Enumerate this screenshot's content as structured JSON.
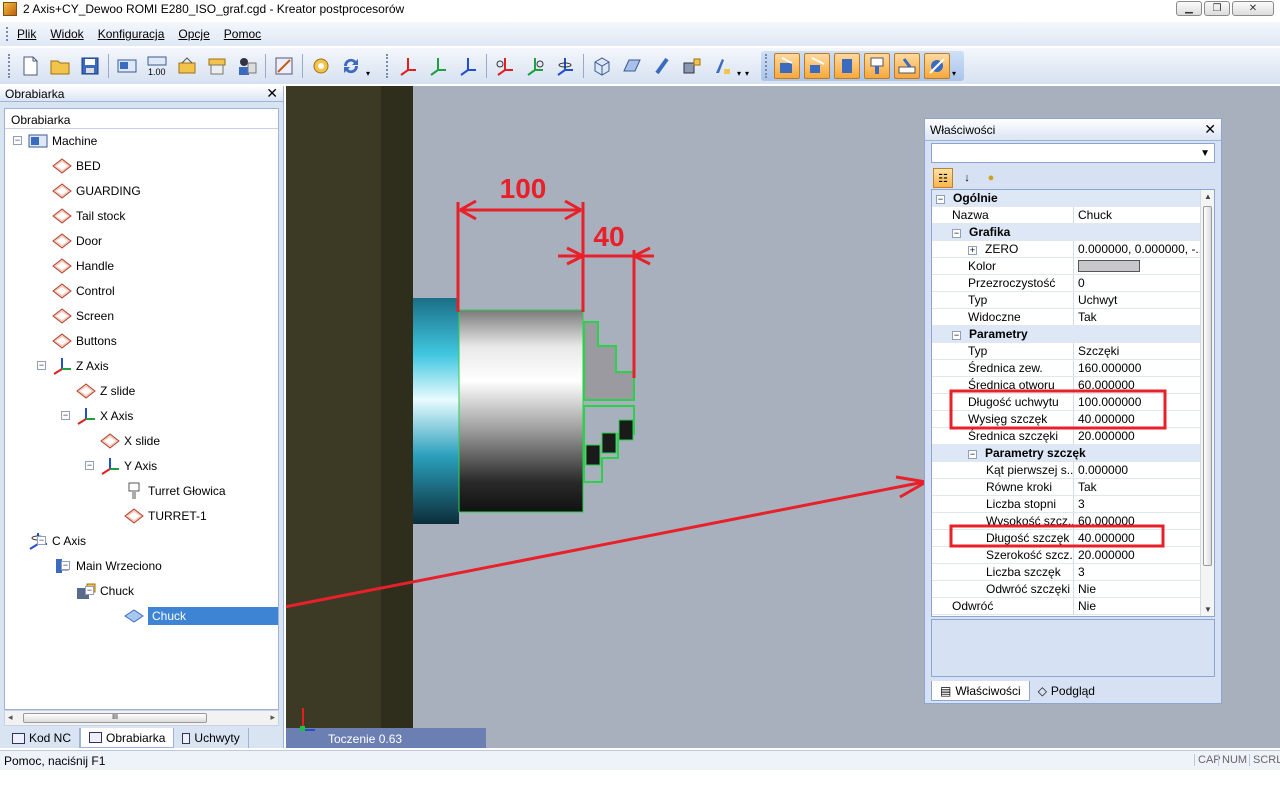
{
  "window": {
    "title": "2 Axis+CY_Dewoo ROMI E280_ISO_graf.cgd - Kreator postprocesorów",
    "btn_min": "▁",
    "btn_max": "❐",
    "btn_close": "✕"
  },
  "menu": [
    "Plik",
    "Widok",
    "Konfiguracja",
    "Opcje",
    "Pomoc"
  ],
  "left_panel": {
    "title": "Obrabiarka",
    "close": "✕",
    "tree_header": "Obrabiarka",
    "nodes": [
      {
        "label": "Machine",
        "icon": "machine-icon"
      },
      {
        "label": "BED",
        "icon": "part-icon"
      },
      {
        "label": "GUARDING",
        "icon": "part-icon"
      },
      {
        "label": "Tail stock",
        "icon": "part-icon"
      },
      {
        "label": "Door",
        "icon": "part-icon"
      },
      {
        "label": "Handle",
        "icon": "part-icon"
      },
      {
        "label": "Control",
        "icon": "part-icon"
      },
      {
        "label": "Screen",
        "icon": "part-icon"
      },
      {
        "label": "Buttons",
        "icon": "part-icon"
      },
      {
        "label": "Z Axis",
        "icon": "axis-icon"
      },
      {
        "label": "Z slide",
        "icon": "part-icon"
      },
      {
        "label": "X Axis",
        "icon": "axis-icon"
      },
      {
        "label": "X slide",
        "icon": "part-icon"
      },
      {
        "label": "Y Axis",
        "icon": "axis-icon"
      },
      {
        "label": "Turret Głowica",
        "icon": "turret-icon"
      },
      {
        "label": "TURRET-1",
        "icon": "part-icon"
      },
      {
        "label": "C Axis",
        "icon": "rotary-axis-icon"
      },
      {
        "label": "Main Wrzeciono",
        "icon": "spindle-icon"
      },
      {
        "label": "Chuck",
        "icon": "chuck-holder-icon"
      },
      {
        "label": "Chuck",
        "icon": "chuck-icon",
        "selected": true
      }
    ],
    "tabs": [
      "Kod NC",
      "Obrabiarka",
      "Uchwyty"
    ],
    "active_tab": "Obrabiarka",
    "scroll_mark": "III"
  },
  "viewport": {
    "dimension_1": "100",
    "dimension_2": "40",
    "status_label": "Toczenie 0.63",
    "colors": {
      "annotation": "#e8202a",
      "profile": "#2bd14a",
      "background": "#a8b0bd"
    }
  },
  "properties": {
    "title": "Właściwości",
    "close": "✕",
    "rows": [
      {
        "type": "cat",
        "name": "Ogólnie",
        "level": 0
      },
      {
        "name": "Nazwa",
        "value": "Chuck",
        "level": 1
      },
      {
        "type": "cat",
        "name": "Grafika",
        "level": 1
      },
      {
        "name": "ZERO",
        "value": "0.000000, 0.000000, -...",
        "level": 2,
        "expandable": true
      },
      {
        "name": "Kolor",
        "value": "",
        "level": 2,
        "swatch": "#c8c8cc"
      },
      {
        "name": "Przezroczystość",
        "value": "0",
        "level": 2
      },
      {
        "name": "Typ",
        "value": "Uchwyt",
        "level": 2
      },
      {
        "name": "Widoczne",
        "value": "Tak",
        "level": 2
      },
      {
        "type": "cat",
        "name": "Parametry",
        "level": 1
      },
      {
        "name": "Typ",
        "value": "Szczęki",
        "level": 2
      },
      {
        "name": "Średnica zew.",
        "value": "160.000000",
        "level": 2
      },
      {
        "name": "Średnica otworu",
        "value": "60.000000",
        "level": 2
      },
      {
        "name": "Długość uchwytu",
        "value": "100.000000",
        "level": 2
      },
      {
        "name": "Wysięg szczęk",
        "value": "40.000000",
        "level": 2
      },
      {
        "name": "Średnica szczęki",
        "value": "20.000000",
        "level": 2
      },
      {
        "type": "cat",
        "name": "Parametry szczęk",
        "level": 2
      },
      {
        "name": "Kąt pierwszej s...",
        "value": "0.000000",
        "level": 3
      },
      {
        "name": "Równe kroki",
        "value": "Tak",
        "level": 3
      },
      {
        "name": "Liczba stopni",
        "value": "3",
        "level": 3
      },
      {
        "name": "Wysokość szcz...",
        "value": "60.000000",
        "level": 3
      },
      {
        "name": "Długość szczęk",
        "value": "40.000000",
        "level": 3
      },
      {
        "name": "Szerokość szcz...",
        "value": "20.000000",
        "level": 3
      },
      {
        "name": "Liczba szczęk",
        "value": "3",
        "level": 3
      },
      {
        "name": "Odwróć szczęki",
        "value": "Nie",
        "level": 3
      },
      {
        "name": "Odwróć",
        "value": "Nie",
        "level": 1
      }
    ],
    "tabs": [
      "Właściwości",
      "Podgląd"
    ],
    "active_tab": "Właściwości"
  },
  "status": {
    "text": "Pomoc, naciśnij F1",
    "cap": "CAP",
    "num": "NUM",
    "scrl": "SCRL"
  }
}
